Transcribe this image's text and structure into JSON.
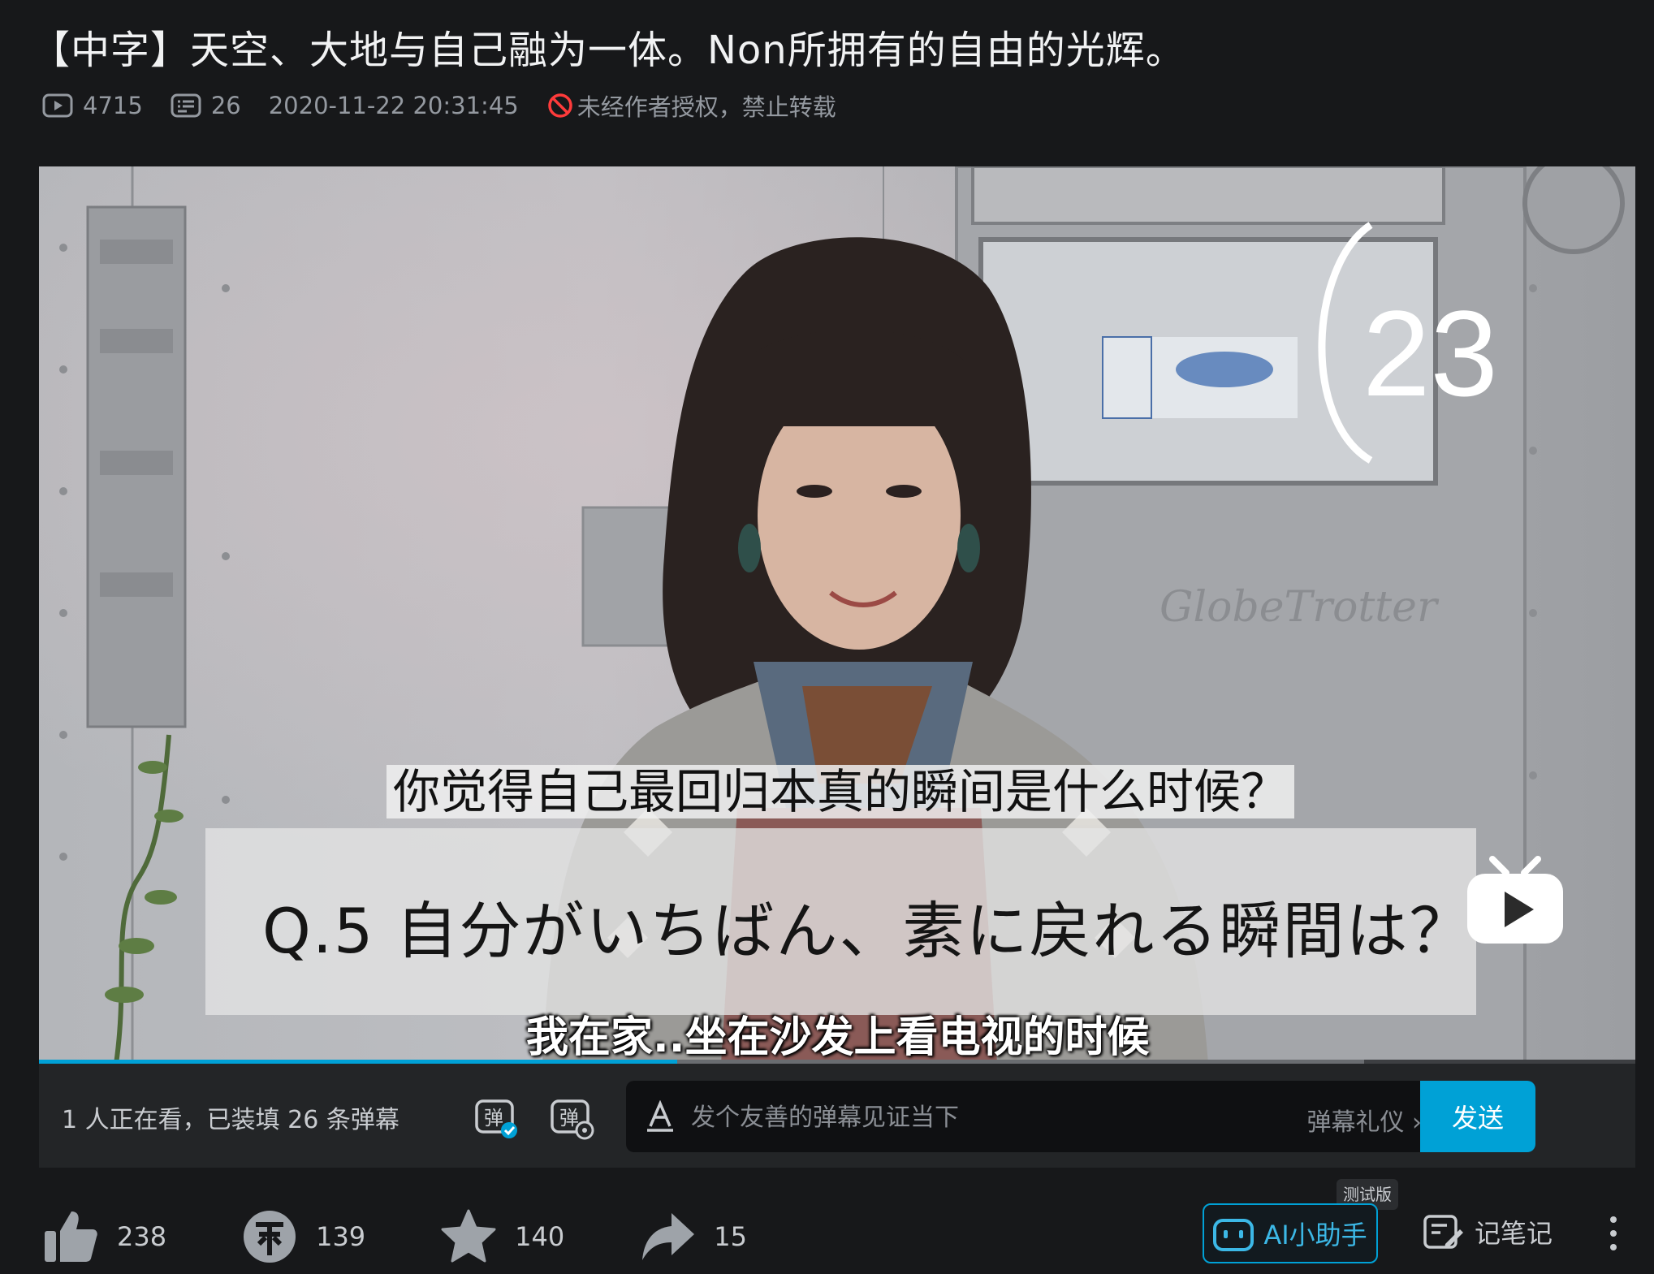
{
  "video": {
    "title": "【中字】天空、大地与自己融为一体。Non所拥有的自由的光辉。",
    "views": "4715",
    "danmaku_count": "26",
    "publish_time": "2020-11-22 20:31:45",
    "copyright_notice": "未经作者授权，禁止转载"
  },
  "player": {
    "subtitle_cn": "你觉得自己最回归本真的瞬间是什么时候？",
    "question_jp": "Q.5 自分がいちばん、素に戻れる瞬間は？",
    "answer_cn": "我在家..坐在沙发上看电视的时候",
    "badge_number": "23",
    "progress": 0.4,
    "buffered": 0.83
  },
  "danmaku_bar": {
    "viewer_text": "1 人正在看，已装填 26 条弹幕",
    "placeholder": "发个友善的弹幕见证当下",
    "etiquette": "弹幕礼仪 ›",
    "send_label": "发送"
  },
  "actions": {
    "like": "238",
    "coin": "139",
    "favorite": "140",
    "share": "15"
  },
  "ai_assistant": {
    "label": "AI小助手",
    "beta": "测试版"
  },
  "notes": {
    "label": "记笔记"
  },
  "colors": {
    "accent": "#00a1d6",
    "background": "#17181a",
    "warning": "#ff3b3b"
  }
}
